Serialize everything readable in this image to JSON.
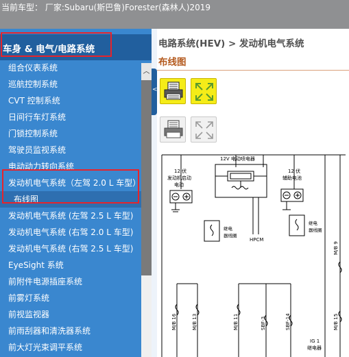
{
  "topbar": {
    "title": "当前车型： 厂家:Subaru(斯巴鲁)Forester(森林人)2019"
  },
  "sidebar": {
    "header": "车身 & 电气/电路系统",
    "items": [
      {
        "label": "组合仪表系统"
      },
      {
        "label": "巡航控制系统"
      },
      {
        "label": "CVT 控制系统"
      },
      {
        "label": "日间行车灯系统"
      },
      {
        "label": "门锁控制系统"
      },
      {
        "label": "驾驶员监视系统"
      },
      {
        "label": "电动动力转向系统"
      },
      {
        "label": "发动机电气系统（左驾 2.0 L 车型）"
      },
      {
        "label": "布线图"
      },
      {
        "label": "发动机电气系统 (左驾 2.5 L 车型)"
      },
      {
        "label": "发动机电气系统 (右驾 2.0 L 车型)"
      },
      {
        "label": "发动机电气系统 (右驾 2.5 L 车型)"
      },
      {
        "label": "EyeSight 系统"
      },
      {
        "label": "前附件电源插座系统"
      },
      {
        "label": "前雾灯系统"
      },
      {
        "label": "前视监视器"
      },
      {
        "label": "前雨刮器和清洗器系统"
      },
      {
        "label": "前大灯光束调平系统"
      }
    ],
    "scroll_up_glyph": "︿"
  },
  "splitter": {
    "glyph": "<"
  },
  "content": {
    "breadcrumb": "电路系统(HEV) > 发动机电气系统",
    "subtitle": "布线图"
  },
  "icons": {
    "print": "printer-icon",
    "expand": "expand-arrows-icon"
  },
  "colors": {
    "active_button": "#f5ec18",
    "sidebar": "#3a87cf",
    "sidebar_header": "#215f9e",
    "highlight_box": "#e8232a",
    "subtitle": "#b45a1e"
  },
  "diagram": {
    "labels": {
      "relay_12v": "12V 电动喷电器",
      "starter_12v": "12 伏",
      "starter_name": "发动机启动",
      "starter_sub": "电动",
      "aux_12v": "12 伏",
      "aux_name": "辅助电池",
      "relay_coil_left": "继电",
      "relay_coil_left2": "器线圈",
      "hpcm": "HPCM",
      "relay_coil_right": "继电",
      "relay_coil_right2": "器线圈",
      "mb9": "M/B 9",
      "mb16": "M/B 16",
      "mb13": "M/B 13",
      "mb11": "M/B 11",
      "sbf3": "SBF-3",
      "sbf14": "SBF-14",
      "mb15": "M/B 15",
      "ig1": "IG 1",
      "ig1_sub": "继电器"
    }
  }
}
